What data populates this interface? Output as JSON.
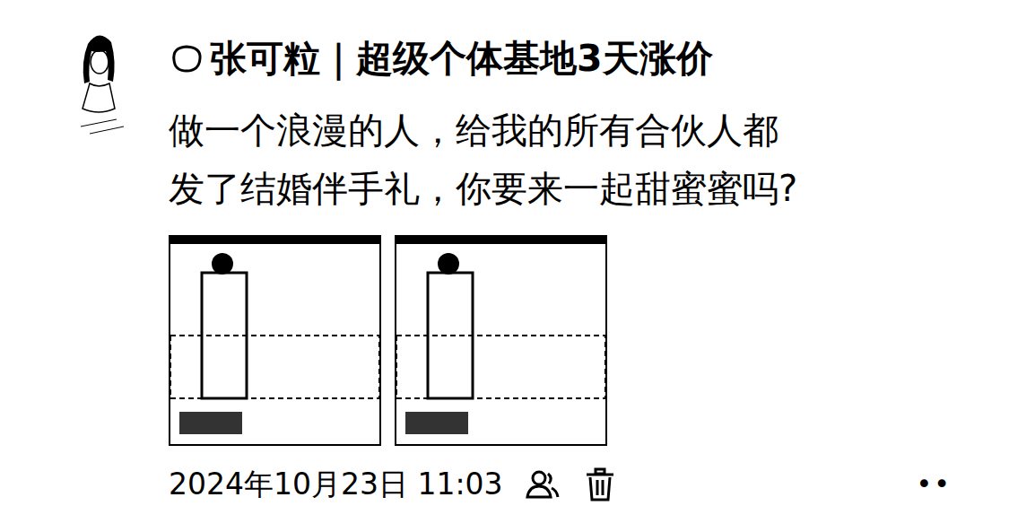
{
  "post": {
    "author": "张可粒｜超级个体基地3天涨价",
    "lines": [
      "做一个浪漫的人，给我的所有合伙人都",
      "发了结婚伴手礼，你要来一起甜蜜蜜吗?"
    ],
    "time": "2024年10月23日 11:03",
    "more": "••"
  }
}
